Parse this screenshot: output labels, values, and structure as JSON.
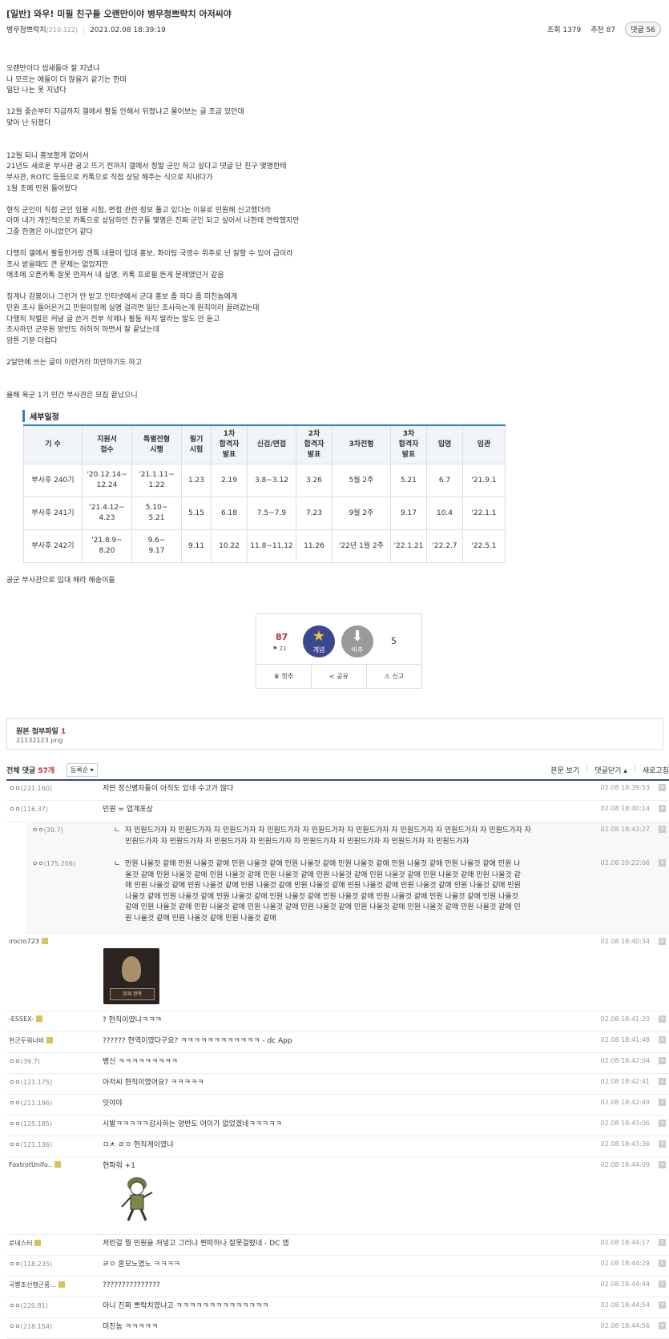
{
  "post": {
    "title": "[일반] 와우! 미필 친구들 오랜만이야 병무청쁘락치 아저씨야",
    "author": "병무청쁘락치",
    "author_ip": "(210.122)",
    "date": "2021.02.08 18:39:19",
    "views": "조회 1379",
    "recommends": "추천 87",
    "comment_badge": "댓글 56",
    "body_lines": [
      "오랜만이다 씹새들아 잘 지냈냐",
      "나 모르는 애들이 더 많을거 같기는 한데",
      "일단 나는 못 지냈다",
      "",
      "12월 중순부터 지금까지 갤에서 활동 안해서 뒤졌냐고 물어보는 글 조금 있던데",
      "맞아 난 뒤졌다",
      "",
      "",
      "12월 되니 홍보할게 없어서",
      "21년도 새로운 부사관 공고 뜨기 전까지 갤에서 정말 군인 하고 싶다고 댓글 단 친구 몇명한테",
      "부사관, ROTC 등등으로 카톡으로 직접 상담 해주는 식으로 지내다가",
      "1월 초에 민원 들어왔다",
      "",
      "현직 군인이 직접 군인 임용 시험, 면접 관련 정보 풀고 있다는 이유로 민원해 신고했더라",
      "아마 내가 개인적으로 카톡으로 상담하던 친구들 몇명은 진짜 군인 되고 싶어서 나한테 연락했지만",
      "그중 한명은 아니었던거 같다",
      "",
      "다행히 갤에서 활동한거랑 갠톡 내용이 입대 홍보, 화이팅 국영수 위주로 넌 잘할 수 있어 급이라",
      "조사 받을때도 큰 문제는 없었지만",
      "애초에 오픈카톡 잘못 만져서 내 실명, 카톡 프로필 뜬게 문제였던거 같음",
      "",
      "징계나 감봉이나 그런거 안 받고 인터넷에서 군대 홍보 좀 하다 좀 미친놈에게",
      "민원 조사 들어온거고 민원이랑께 실명 걸리면 일단 조사하는게 원칙이라 끌려갔는데",
      "다행히 처벌은 커녕 글 쓴거 전부 삭제나 활동 하지 말라는 말도 안 듣고",
      "조사하던 군무원 양반도 허허허 하면서 잘 끝났는데",
      "암튼 기분 더럽다",
      "",
      "2달만에 쓰는 글이 이런거라 미안하기도 하고",
      "",
      "",
      "올해 육군 1기 민간 부사관은 모집 끝났으니"
    ],
    "body_after": "공군 부사관으로 입대 해라 해송이들"
  },
  "schedule": {
    "title": "세부일정",
    "headers": [
      "기 수",
      "지원서\n접수",
      "특별전형\n시행",
      "필기\n시험",
      "1차\n합격자\n발표",
      "신검/면접",
      "2차\n합격자\n발표",
      "3차전형",
      "3차\n합격자\n발표",
      "입영",
      "임관"
    ],
    "rows": [
      [
        "부사후 240기",
        "'20.12.14~\n12.24",
        "'21.1.11~\n1.22",
        "1.23",
        "2.19",
        "3.8~3.12",
        "3.26",
        "5월 2주",
        "5.21",
        "6.7",
        "'21.9.1"
      ],
      [
        "부사후 241기",
        "'21.4.12~\n4.23",
        "5.10~\n5.21",
        "5.15",
        "6.18",
        "7.5~7.9",
        "7.23",
        "9월 2주",
        "9.17",
        "10.4",
        "'22.1.1"
      ],
      [
        "부사후 242기",
        "'21.8.9~\n8.20",
        "9.6~\n9.17",
        "9.11",
        "10.22",
        "11.8~11.12",
        "11.26",
        "'22년 1월 2주",
        "'22.1.21",
        "'22.2.7",
        "'22.5.1"
      ]
    ]
  },
  "vote": {
    "up_count": "87",
    "fixed_count": "21",
    "up_label": "개념",
    "down_label": "비추",
    "down_count": "5",
    "actions": [
      "힛추",
      "공유",
      "신고"
    ]
  },
  "files": {
    "title": "원본 첨부파일",
    "count": "1",
    "name": "21132123.png"
  },
  "comments_bar": {
    "label": "전체 댓글",
    "count": "57개",
    "sort": "등록순",
    "view_post": "본문 보기",
    "collapse": "댓글닫기",
    "refresh": "새로고침"
  },
  "comments": [
    {
      "nick": "ㅇㅇ",
      "ip": "(221.160)",
      "text": "저딴 정신병자들이 아직도 있네 수고가 많다",
      "time": "02.08 18:39:53"
    },
    {
      "nick": "ㅇㅇ",
      "ip": "(116.37)",
      "text": "민원 = 업계포상",
      "time": "02.08 18:40:14"
    },
    {
      "nick": "ㅇㅇ",
      "ip": "(39.7)",
      "text": "ㄴ  자 민원드가자 자 민원드가자 자 민원드가자 자 민원드가자 자 민원드가자 자 민원드가자 자 민원드가자 자 민원드가자 자 민원드가자 자\n     민원드가자 자 민원드가자 자 민원드가자 자 민원드가자 자 민원드가자 자 민원드가자 자 민원드가자 자 민원드가자",
      "time": "02.08 18:43:27"
    },
    {
      "nick": "ㅇㅇ",
      "ip": "(175.206)",
      "text": "ㄴ  민원 나올것 같애 민원 나올것 같애 민원 나올것 같애 민원 나올것 같애 민원 나올것 같애 민원 나올것 같애 민원 나올것 같애 민원 나\n     올것 같애 민원 나올것 같애 민원 나올것 같애 민원 나올것 같애 민원 나올것 같애 민원 나올것 같애 민원 나올것 같애 민원 나올것 같\n     애 민원 나올것 같애 민원 나올것 같애 민원 나올것 같애 민원 나올것 같애 민원 나올것 같애 민원 나올것 같애 민원 나올것 같애 민원\n     나올것 같애 민원 나올것 같애 민원 나올것 같애 민원 나올것 같애 민원 나올것 같애 민원 나올것 같애 민원 나올것 같애 민원 나올것\n     같애 민원 나올것 같애 민원 나올것 같애 민원 나올것 같애 민원 나올것 같애 민원 나올것 같애 민원 나올것 같애 민원 나올것 같애 민\n     원 나올것 같애 민원 나올것 같애 민원 나올것 같애",
      "time": "02.08 20:22:06"
    },
    {
      "nick": "irocro723",
      "ip": "",
      "text": "",
      "image_label": "정재 정복",
      "time": "02.08 18:40:34"
    },
    {
      "nick": "-ESSEX-",
      "ip": "",
      "text": "? 현직이였냐ㅋㅋㅋ",
      "time": "02.08 18:41:20"
    },
    {
      "nick": "한군두워너비",
      "ip": "",
      "text": "?????? 현역이였다구요? ㅋㅋㅋㅋㅋㅋㅋㅋㅋㅋㅋㅋ - dc App",
      "time": "02.08 18:41:48"
    },
    {
      "nick": "ㅇㅇ",
      "ip": "(39.7)",
      "text": "병신 ㅋㅋㅋㅋㅋㅋㅋㅋㅋ",
      "time": "02.08 18:42:04"
    },
    {
      "nick": "ㅇㅇ",
      "ip": "(121.175)",
      "text": "아저씨 현직이였어요? ㅋㅋㅋㅋㅋ",
      "time": "02.08 18:42:41"
    },
    {
      "nick": "ㅇㅇ",
      "ip": "(211.196)",
      "text": "잇야야",
      "time": "02.08 18:42:49"
    },
    {
      "nick": "ㅇㅇ",
      "ip": "(125.185)",
      "text": "시발ㅋㅋㅋㅋㅋ감사하는 양반도 어이가 없었겠네ㅋㅋㅋㅋㅋ",
      "time": "02.08 18:43:06"
    },
    {
      "nick": "ㅇㅇ",
      "ip": "(121.136)",
      "text": "ㅁㅊ ㄹㅇ 현직게이였냐",
      "time": "02.08 18:43:36"
    },
    {
      "nick": "FoxtrotUnifo..",
      "ip": "",
      "text": "현파워 +1",
      "time": "02.08 18:44:09"
    },
    {
      "nick": "로네스터",
      "ip": "",
      "text": "저런걸 뭘 민원을 처넣고 그러냐 찐따하나 잘못걸렸네 - DC 앱",
      "time": "02.08 18:44:17"
    },
    {
      "nick": "ㅇㅇ",
      "ip": "(118.235)",
      "text": "ㄹㅇ 혼모노였노 ㅋㅋㅋㅋ",
      "time": "02.08 18:44:29"
    },
    {
      "nick": "국뽕조선행군룡...",
      "ip": "",
      "text": "???????????????",
      "time": "02.08 18:44:44"
    },
    {
      "nick": "ㅇㅇ",
      "ip": "(220.81)",
      "text": "아니 진짜 쁘락치였냐고 ㅋㅋㅋㅋㅋㅋㅋㅋㅋㅋㅋㅋㅋㅋ",
      "time": "02.08 18:44:54"
    },
    {
      "nick": "ㅇㅇ",
      "ip": "(218.154)",
      "text": "미친놈 ㅋㅋㅋㅋㅋ",
      "time": "02.08 18:44:56"
    }
  ]
}
